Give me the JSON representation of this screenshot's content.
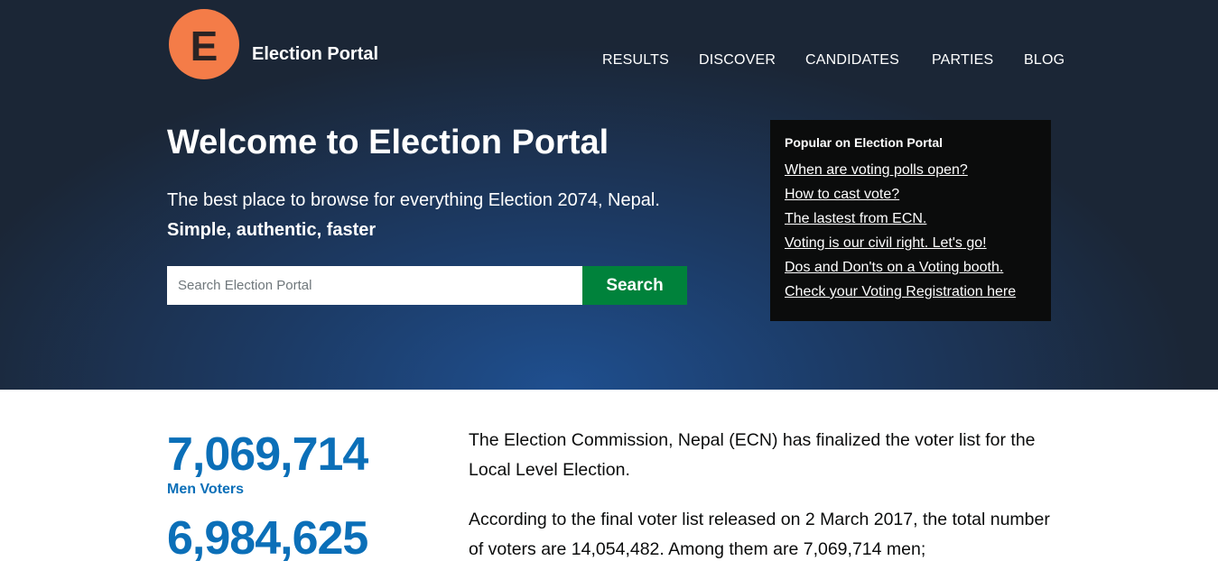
{
  "brand": {
    "logo_letter": "E",
    "name": "Election Portal",
    "logo_color": "#f47c48"
  },
  "nav": {
    "items": [
      {
        "label": "RESULTS"
      },
      {
        "label": "DISCOVER"
      },
      {
        "label": "CANDIDATES"
      },
      {
        "label": "PARTIES"
      },
      {
        "label": "BLOG"
      }
    ]
  },
  "hero": {
    "title": "Welcome to Election Portal",
    "tagline": "The best place to browse for everything Election 2074, Nepal.",
    "slogan": "Simple, authentic, faster"
  },
  "search": {
    "placeholder": "Search Election Portal",
    "value": "",
    "button_label": "Search",
    "button_color": "#00823b"
  },
  "popular": {
    "heading": "Popular on Election Portal",
    "links": [
      {
        "label": "When are voting polls open?"
      },
      {
        "label": "How to cast vote?"
      },
      {
        "label": "The lastest from ECN."
      },
      {
        "label": "Voting is our civil right. Let's go!"
      },
      {
        "label": "Dos and Don'ts on a Voting booth."
      },
      {
        "label": "Check your Voting Registration here"
      }
    ]
  },
  "stats": {
    "men": {
      "value": "7,069,714",
      "label": "Men Voters"
    },
    "women": {
      "value": "6,984,625"
    },
    "accent_color": "#0b6fb8"
  },
  "content": {
    "para1": "The Election Commission, Nepal (ECN) has finalized the voter list for the Local Level Election.",
    "para2": "According to the final voter list released on 2 March 2017, the total number of voters are 14,054,482. Among them are 7,069,714 men;"
  }
}
